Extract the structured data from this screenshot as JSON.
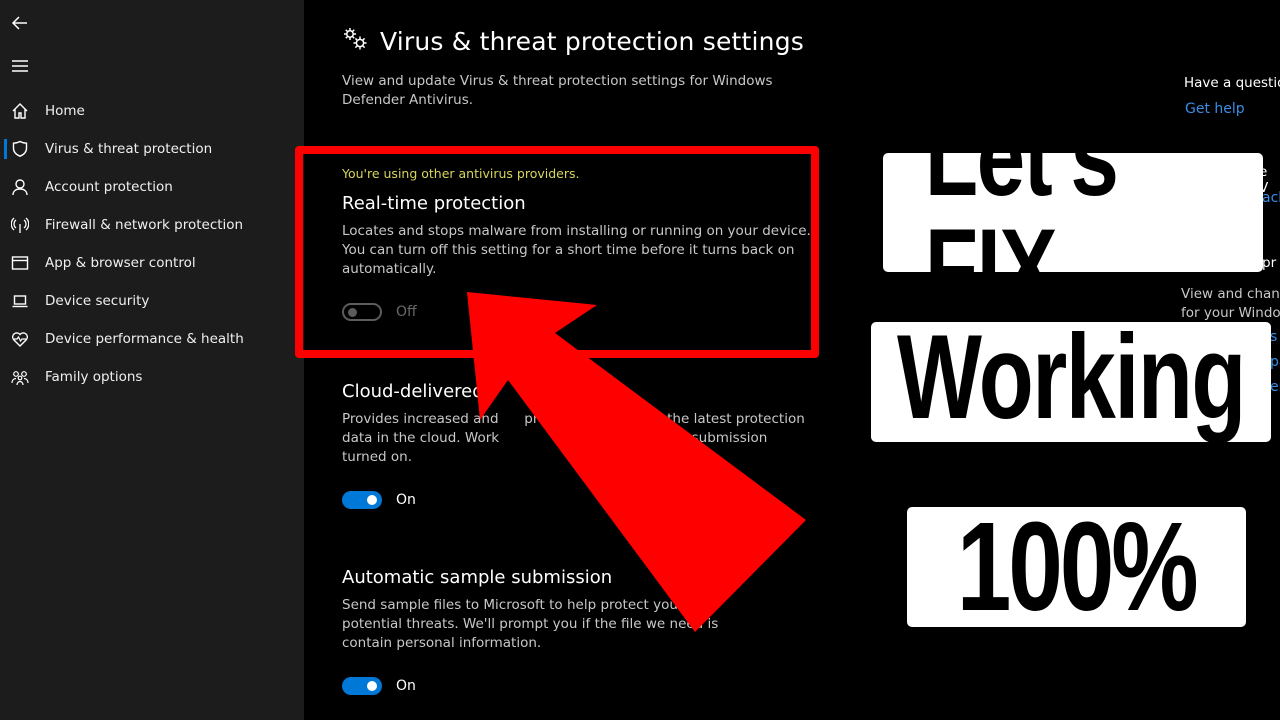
{
  "sidebar": {
    "back_icon": "back-arrow-icon",
    "menu_icon": "hamburger-menu-icon",
    "items": [
      {
        "label": "Home",
        "icon": "home-icon",
        "active": false
      },
      {
        "label": "Virus & threat protection",
        "icon": "shield-icon",
        "active": true
      },
      {
        "label": "Account protection",
        "icon": "person-icon",
        "active": false
      },
      {
        "label": "Firewall & network protection",
        "icon": "wifi-antenna-icon",
        "active": false
      },
      {
        "label": "App & browser control",
        "icon": "browser-window-icon",
        "active": false
      },
      {
        "label": "Device security",
        "icon": "laptop-icon",
        "active": false
      },
      {
        "label": "Device performance & health",
        "icon": "heart-pulse-icon",
        "active": false
      },
      {
        "label": "Family options",
        "icon": "family-icon",
        "active": false
      }
    ]
  },
  "main": {
    "title": "Virus & threat protection settings",
    "title_icon": "gears-icon",
    "subtitle": "View and update Virus & threat protection settings for Windows Defender Antivirus.",
    "sections": [
      {
        "warning": "You're using other antivirus providers.",
        "heading": "Real-time protection",
        "description": "Locates and stops malware from installing or running on your device. You can turn off this setting for a short time before it turns back on automatically.",
        "toggle_state": "Off"
      },
      {
        "heading": "Cloud-delivered",
        "description": "Provides increased and      pr                              the latest protection data in the cloud. Work                                    mple submission turned on.",
        "toggle_state": "On"
      },
      {
        "heading": "Automatic sample submission",
        "description": "Send sample files to Microsoft to help protect you and                     potential threats. We'll prompt you if the file we need is            contain personal information.",
        "toggle_state": "On"
      }
    ]
  },
  "right_panel": {
    "question": "Have a question?",
    "get_help": "Get help",
    "partial_1": "e V",
    "partial_link_1": "ack",
    "partial_2": "pr",
    "partial_desc": "View and change\nfor your Windo",
    "partial_links": [
      "s",
      "pa",
      "er"
    ]
  },
  "overlay": {
    "line1": "Let's FIX",
    "line2": "Working",
    "line3": "100%",
    "highlight_color": "#ff0000",
    "arrow_color": "#ff0000"
  }
}
